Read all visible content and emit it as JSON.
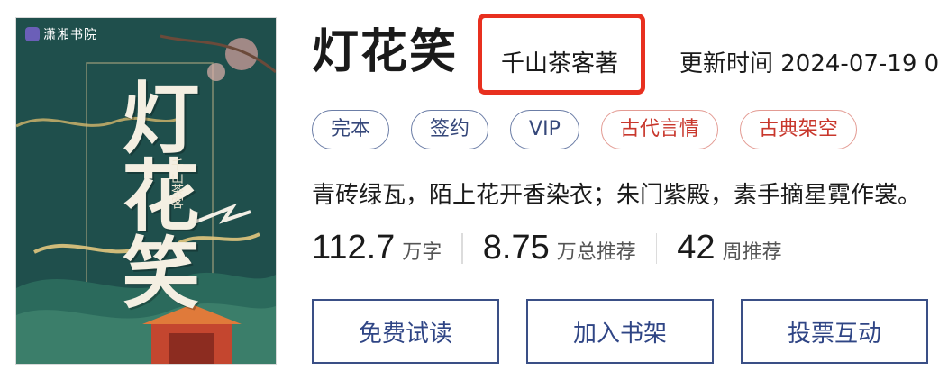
{
  "cover": {
    "publisher": "潇湘书院",
    "title_art": "灯花笑",
    "author_art": "千山茶客"
  },
  "book": {
    "title": "灯花笑",
    "author": "千山茶客著",
    "update_time": "更新时间 2024-07-19 0"
  },
  "tags": [
    "完本",
    "签约",
    "VIP",
    "古代言情",
    "古典架空"
  ],
  "synopsis": "青砖绿瓦，陌上花开香染衣；朱门紫殿，素手摘星霓作裳。",
  "stats": [
    {
      "value": "112.7",
      "unit": "万字"
    },
    {
      "value": "8.75",
      "unit": "万总推荐"
    },
    {
      "value": "42",
      "unit": "周推荐"
    }
  ],
  "actions": {
    "read": "免费试读",
    "shelf": "加入书架",
    "vote": "投票互动"
  },
  "colors": {
    "highlight": "#e8301f",
    "accent": "#2f4585",
    "tag_red": "#c8372c"
  }
}
